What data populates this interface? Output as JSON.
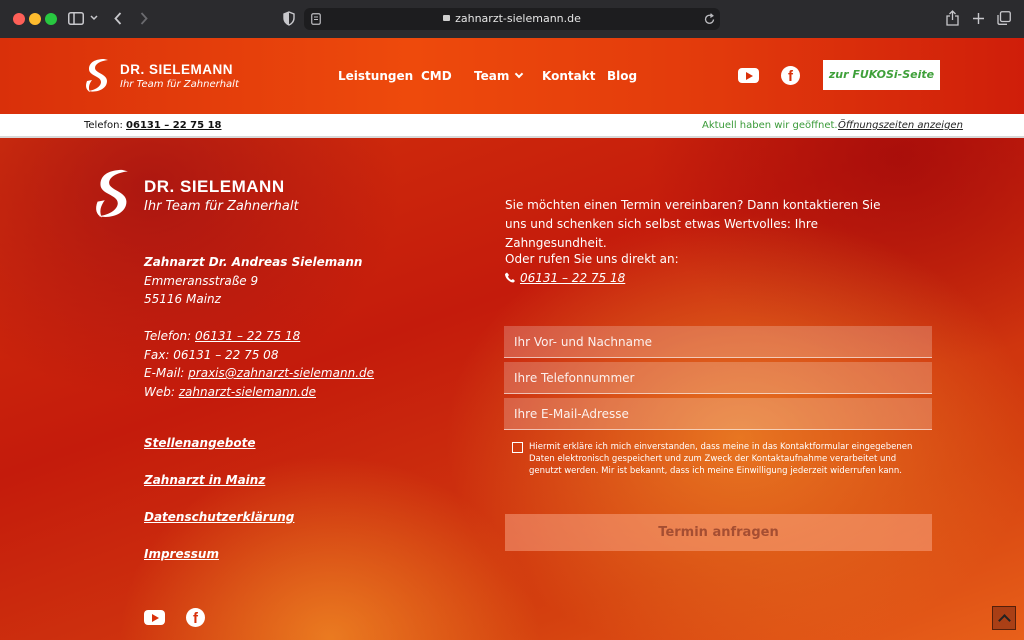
{
  "browser": {
    "url": "zahnarzt-sielemann.de"
  },
  "header": {
    "logo": {
      "name": "DR. SIELEMANN",
      "tagline": "Ihr Team für Zahnerhalt"
    },
    "nav": [
      {
        "label": "Leistungen"
      },
      {
        "label": "CMD"
      },
      {
        "label": "Team"
      },
      {
        "label": "Kontakt"
      },
      {
        "label": "Blog"
      }
    ],
    "cta_label": "zur FUKOSi-Seite"
  },
  "infobar": {
    "phone_label": "Telefon:",
    "phone_number": "06131 – 22 75 18",
    "open_status": "Aktuell haben wir geöffnet.",
    "hours_link": "Öffnungszeiten anzeigen"
  },
  "footer": {
    "logo": {
      "name": "DR. SIELEMANN",
      "tagline": "Ihr Team für Zahnerhalt"
    },
    "address": {
      "name": "Zahnarzt Dr. Andreas Sielemann",
      "street": "Emmeransstraße 9",
      "city": "55116 Mainz"
    },
    "contact": {
      "phone_label": "Telefon:",
      "phone": "06131 – 22 75 18",
      "fax_label": "Fax: 06131 – 22 75 08",
      "email_label": "E-Mail:",
      "email": "praxis@zahnarzt-sielemann.de",
      "web_label": "Web:",
      "web": "zahnarzt-sielemann.de"
    },
    "links": [
      {
        "label": "Stellenangebote"
      },
      {
        "label": "Zahnarzt in Mainz"
      },
      {
        "label": "Datenschutzerklärung"
      },
      {
        "label": "Impressum"
      }
    ]
  },
  "form": {
    "intro": "Sie möchten einen Termin vereinbaren? Dann kontaktieren Sie uns und schenken sich selbst etwas Wertvolles: Ihre Zahngesundheit.",
    "call_text": "Oder rufen Sie uns direkt an:",
    "call_number": "06131 – 22 75 18",
    "name_placeholder": "Ihr Vor- und Nachname",
    "phone_placeholder": "Ihre Telefonnummer",
    "email_placeholder": "Ihre E-Mail-Adresse",
    "consent": "Hiermit erkläre ich mich einverstanden, dass meine in das Kontaktformular eingegebenen Daten elektronisch gespeichert und zum Zweck der Kontaktaufnahme verarbeitet und genutzt werden. Mir ist bekannt, dass ich meine Einwilligung jederzeit widerrufen kann.",
    "submit_label": "Termin anfragen"
  },
  "icons": {
    "brand_white": "#ffffff",
    "accent_green": "#3fa03a",
    "primary_red": "#d9300a"
  }
}
